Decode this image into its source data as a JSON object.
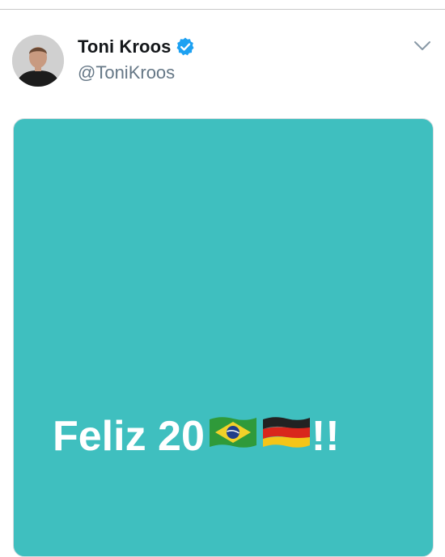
{
  "tweet": {
    "author": {
      "display_name": "Toni Kroos",
      "handle": "@ToniKroos",
      "verified_icon": "verified-badge-icon"
    },
    "menu_icon": "chevron-down-icon",
    "media": {
      "background_color": "#3fbfbf",
      "text_before": "Feliz 20",
      "flag_1": "brazil-flag-icon",
      "flag_2": "germany-flag-icon",
      "text_after": "!!"
    }
  },
  "colors": {
    "name": "#14171a",
    "handle": "#657786",
    "verified_blue": "#1da1f2",
    "divider": "#c9c9c9"
  }
}
